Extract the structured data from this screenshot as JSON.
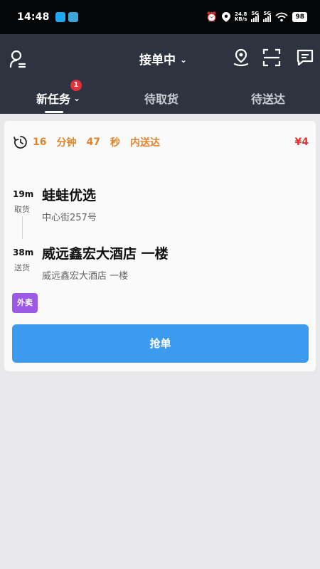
{
  "status_bar": {
    "time": "14:48",
    "net_speed_value": "24.8",
    "net_speed_unit": "KB/s",
    "signal_1": "5G",
    "signal_2": "5G",
    "battery": "98"
  },
  "header": {
    "status_label": "接单中",
    "tabs": [
      {
        "label": "新任务",
        "badge": "1"
      },
      {
        "label": "待取货"
      },
      {
        "label": "待送达"
      }
    ]
  },
  "order": {
    "timer": {
      "minutes": "16",
      "minute_unit": "分钟",
      "seconds": "47",
      "second_unit": "秒",
      "suffix": "内送达"
    },
    "price": "¥4",
    "pickup": {
      "distance": "19m",
      "kind": "取货",
      "name": "蛙蛙优选",
      "address": "中心街257号"
    },
    "dropoff": {
      "distance": "38m",
      "kind": "送货",
      "name": "威远鑫宏大酒店 一楼",
      "address": "威远鑫宏大酒店 一楼"
    },
    "tag": "外卖",
    "grab_button": "抢单"
  },
  "colors": {
    "header_bg": "#2e343f",
    "accent_orange": "#e0842f",
    "price_red": "#e5372f",
    "button_blue": "#3c9bef",
    "tag_purple": "#9b59e6",
    "badge_red": "#e2313b"
  },
  "icons": {
    "profile": "profile-icon",
    "location": "location-pin-icon",
    "scan": "scan-icon",
    "message": "message-icon",
    "timer": "timer-icon"
  }
}
